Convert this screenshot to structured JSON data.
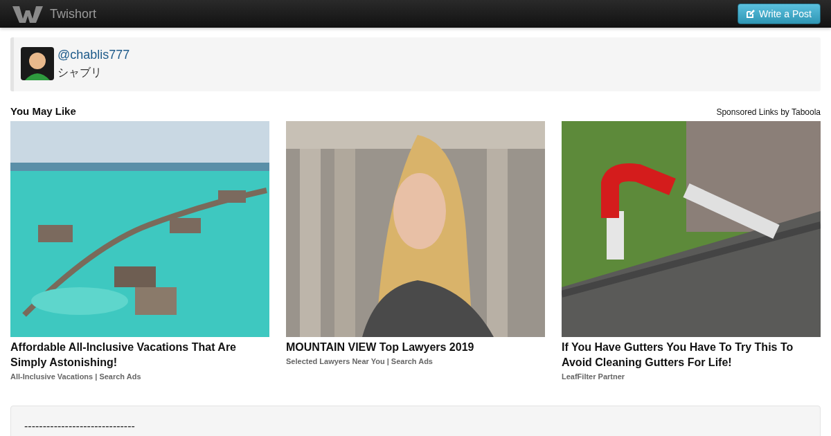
{
  "navbar": {
    "brand": "Twishort",
    "write_button": "Write a Post"
  },
  "post": {
    "username": "@chablis777",
    "display_name": "シャブリ"
  },
  "recommendations": {
    "title": "You May Like",
    "sponsor": "Sponsored Links by Taboola",
    "items": [
      {
        "title": "Affordable All-Inclusive Vacations That Are Simply Astonishing!",
        "source": "All-Inclusive Vacations | Search Ads"
      },
      {
        "title": "MOUNTAIN VIEW Top Lawyers 2019",
        "source": "Selected Lawyers Near You | Search Ads"
      },
      {
        "title": "If You Have Gutters You Have To Try This To Avoid Cleaning Gutters For Life!",
        "source": "LeafFilter Partner"
      }
    ]
  },
  "content": {
    "text": "------------------------------"
  }
}
